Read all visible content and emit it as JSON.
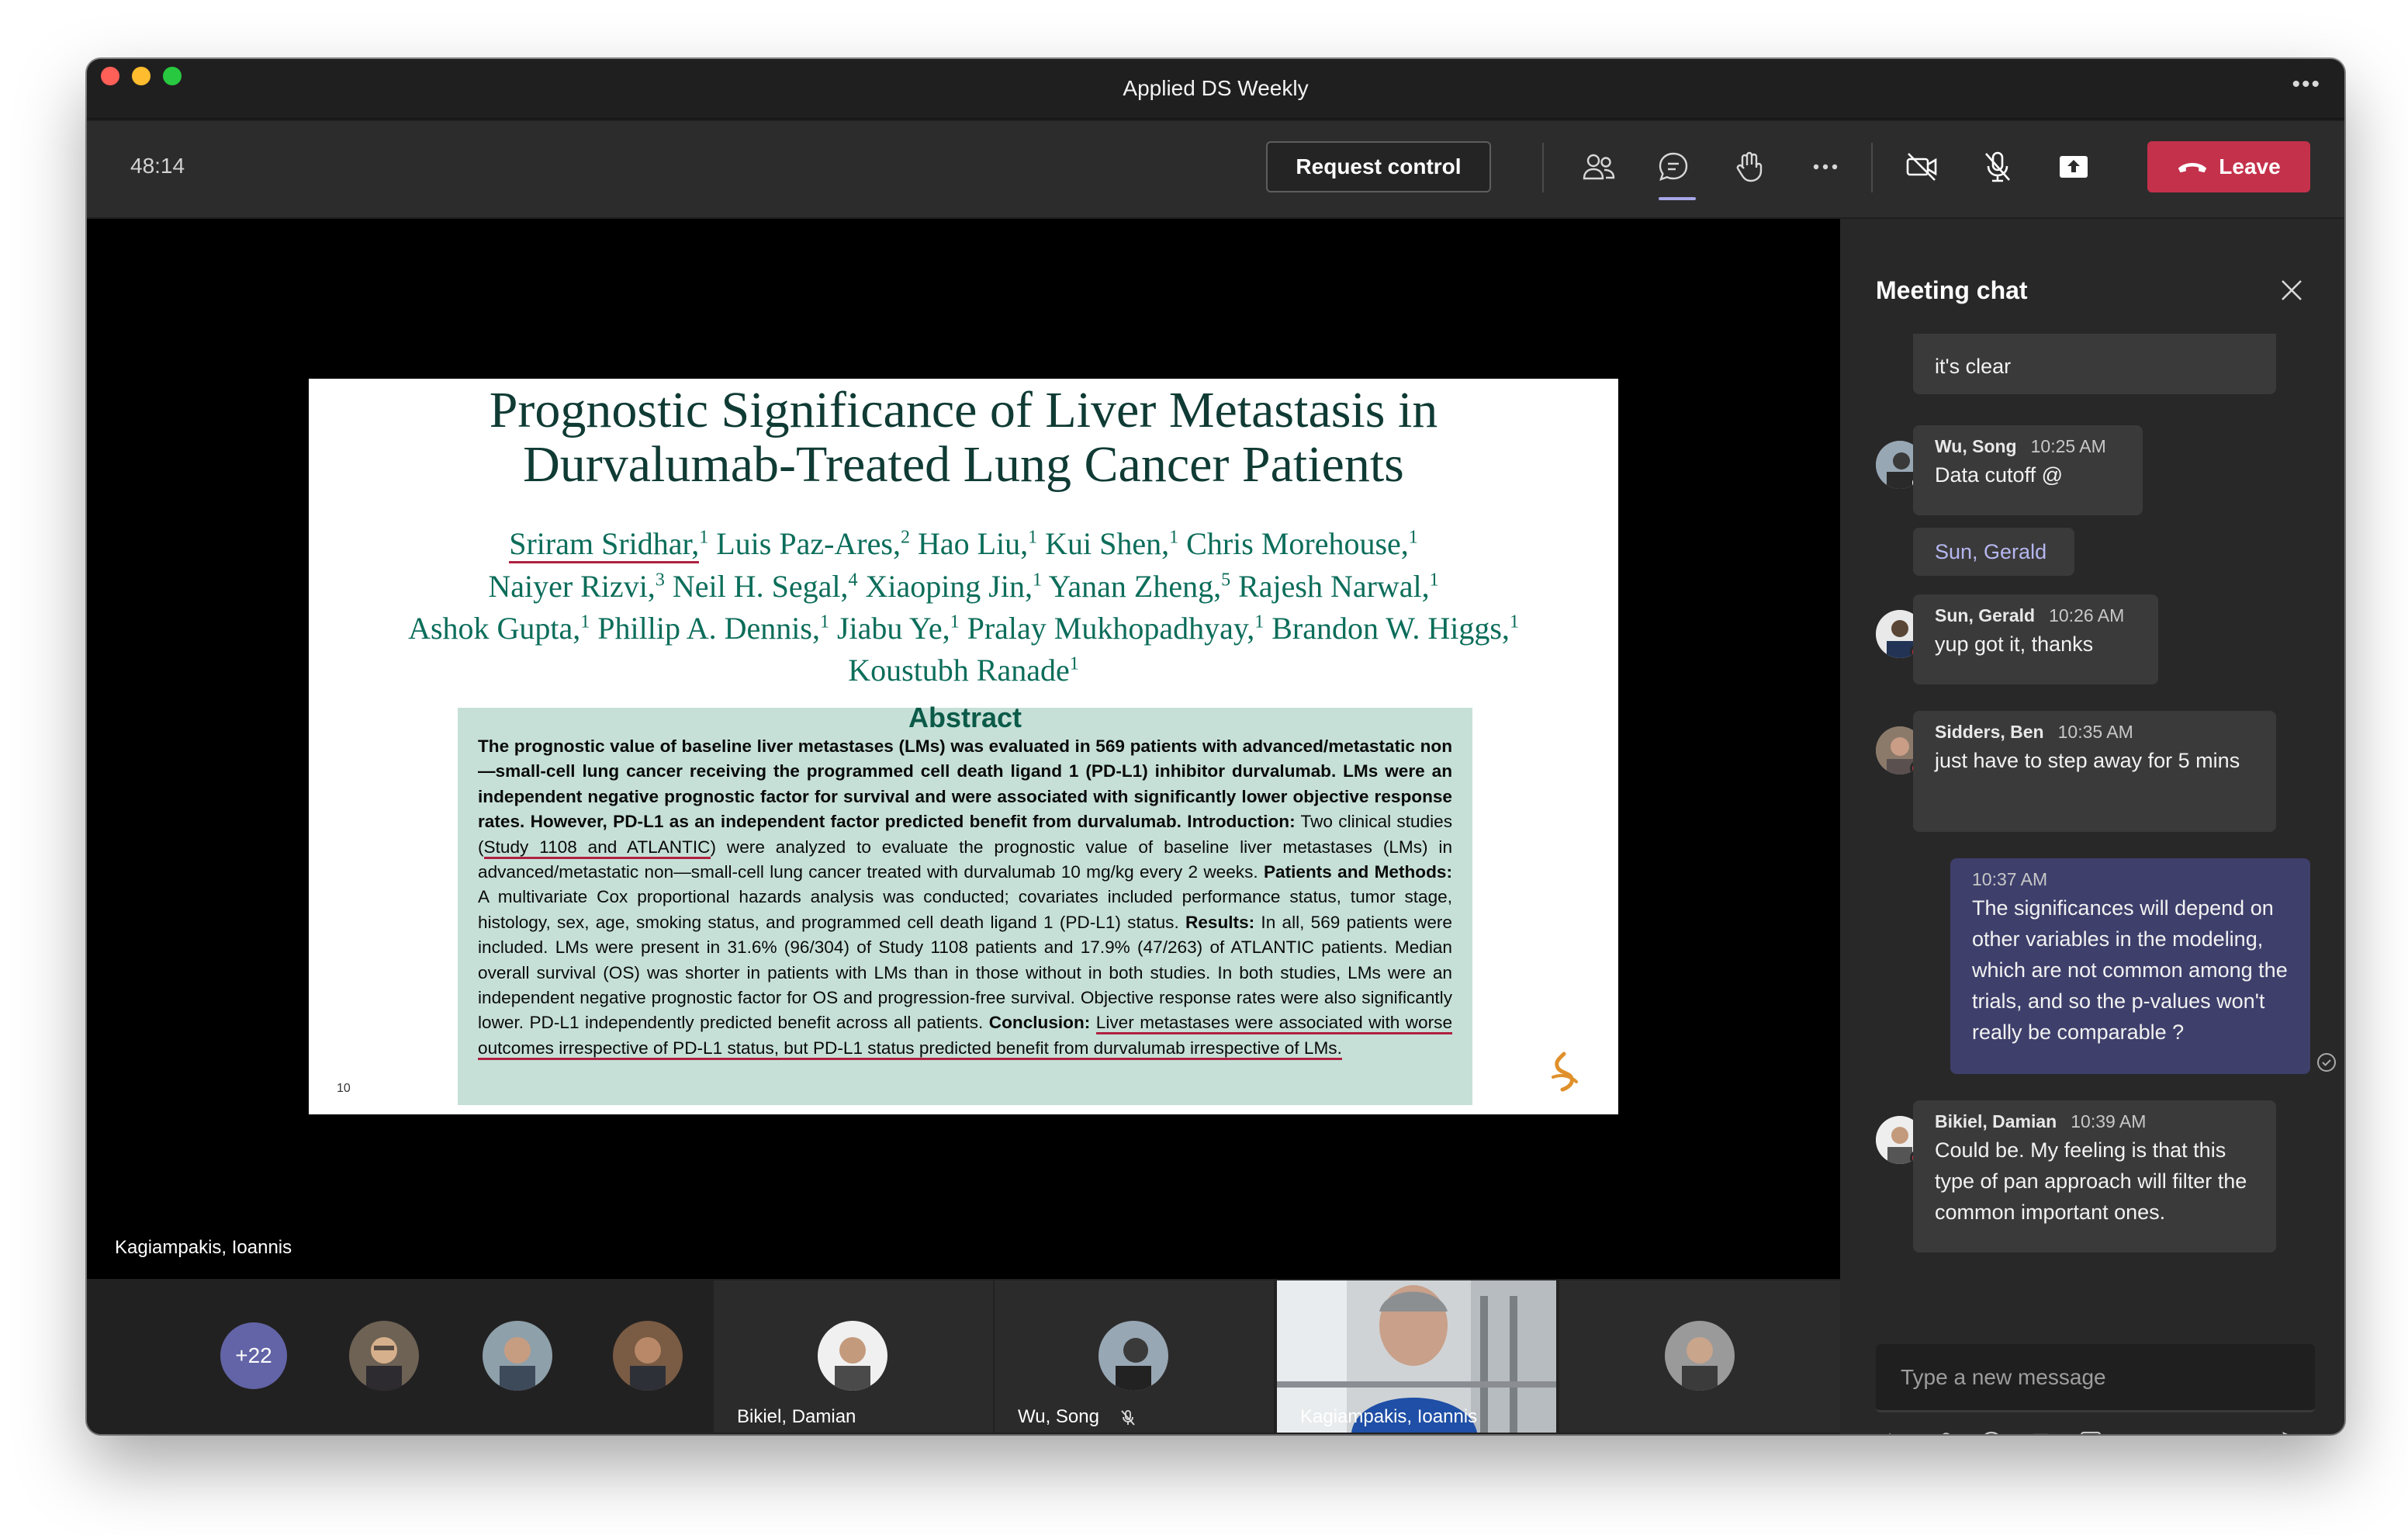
{
  "window": {
    "title": "Applied DS Weekly"
  },
  "toolbar": {
    "timer": "48:14",
    "request_control": "Request control",
    "leave": "Leave",
    "icons": [
      "participants-icon",
      "chat-icon",
      "raise-hand-icon",
      "more-icon",
      "camera-off-icon",
      "mic-off-icon",
      "share-icon"
    ]
  },
  "slide": {
    "title_line1": "Prognostic Significance of Liver Metastasis in",
    "title_line2": "Durvalumab-Treated Lung Cancer Patients",
    "authors": [
      {
        "name": "Sriram Sridhar,",
        "sup": "1"
      },
      {
        "name": "Luis Paz-Ares,",
        "sup": "2"
      },
      {
        "name": "Hao Liu,",
        "sup": "1"
      },
      {
        "name": "Kui Shen,",
        "sup": "1"
      },
      {
        "name": "Chris Morehouse,",
        "sup": "1"
      },
      {
        "name": "Naiyer Rizvi,",
        "sup": "3"
      },
      {
        "name": "Neil H. Segal,",
        "sup": "4"
      },
      {
        "name": "Xiaoping Jin,",
        "sup": "1"
      },
      {
        "name": "Yanan Zheng,",
        "sup": "5"
      },
      {
        "name": "Rajesh Narwal,",
        "sup": "1"
      },
      {
        "name": "Ashok Gupta,",
        "sup": "1"
      },
      {
        "name": "Phillip A. Dennis,",
        "sup": "1"
      },
      {
        "name": "Jiabu Ye,",
        "sup": "1"
      },
      {
        "name": "Pralay Mukhopadhyay,",
        "sup": "1"
      },
      {
        "name": "Brandon W. Higgs,",
        "sup": "1"
      },
      {
        "name": "Koustubh Ranade",
        "sup": "1"
      }
    ],
    "abstract_heading": "Abstract",
    "abstract_summary": "The prognostic value of baseline liver metastases (LMs) was evaluated in 569 patients with advanced/metastatic non—small-cell lung cancer receiving the programmed cell death ligand 1 (PD-L1) inhibitor durvalumab. LMs were an independent negative prognostic factor for survival and were associated with significantly lower objective response rates. However, PD-L1 as an independent factor predicted benefit from durvalumab.",
    "intro_label": "Introduction:",
    "intro_pre": "Two clinical studies (",
    "intro_studies": "Study 1108 and ATLANTIC",
    "intro_post": ") were analyzed to evaluate the prognostic value of baseline liver metastases (LMs) in advanced/metastatic non—small-cell lung cancer treated with durvalumab 10 mg/kg every 2 weeks.",
    "methods_label": "Patients and Methods:",
    "methods_text": "A multivariate Cox proportional hazards analysis was conducted; covariates included performance status, tumor stage, histology, sex, age, smoking status, and programmed cell death ligand 1 (PD-L1) status.",
    "results_label": "Results:",
    "results_text": "In all, 569 patients were included. LMs were present in 31.6% (96/304) of Study 1108 patients and 17.9% (47/263) of ATLANTIC patients. Median overall survival (OS) was shorter in patients with LMs than in those without in both studies. In both studies, LMs were an independent negative prognostic factor for OS and progression-free survival. Objective response rates were also significantly lower. PD-L1 independently predicted benefit across all patients.",
    "conclusion_label": "Conclusion:",
    "conclusion_text": "Liver metastases were associated with worse outcomes irrespective of PD-L1 status, but PD-L1 status predicted benefit from durvalumab irrespective of LMs.",
    "page_number": "10",
    "presenter": "Kagiampakis, Ioannis"
  },
  "chat": {
    "title": "Meeting chat",
    "composer_placeholder": "Type a new message",
    "messages": [
      {
        "text": "it's clear"
      },
      {
        "author": "Wu, Song",
        "time": "10:25 AM",
        "text": "Data cutoff @",
        "mention": "Sun, Gerald"
      },
      {
        "author": "Sun, Gerald",
        "time": "10:26 AM",
        "text": "yup got it, thanks"
      },
      {
        "author": "Sidders, Ben",
        "time": "10:35 AM",
        "text": "just have to step away for 5 mins"
      },
      {
        "time": "10:37 AM",
        "text": "The significances will depend on other variables in the modeling, which are not common among the trials, and so the p-values won't really be comparable ?"
      },
      {
        "author": "Bikiel, Damian",
        "time": "10:39 AM",
        "text": "Could be. My feeling is that this type of pan approach will filter the common important ones."
      }
    ],
    "tools": [
      "format-icon",
      "attach-icon",
      "emoji-icon",
      "gif-icon",
      "sticker-icon",
      "more-options-icon",
      "send-icon"
    ]
  },
  "participants": {
    "overflow_count": "+22",
    "tiles": [
      {
        "name": "Bikiel, Damian"
      },
      {
        "name": "Wu, Song",
        "muted": true
      },
      {
        "name": "Kagiampakis, Ioannis"
      }
    ]
  },
  "colors": {
    "leave": "#c4314b",
    "accent": "#6264a7",
    "abstract_bg": "#c6e0d8",
    "title_teal": "#0b6d5a",
    "my_bubble": "#3e3f6b"
  }
}
